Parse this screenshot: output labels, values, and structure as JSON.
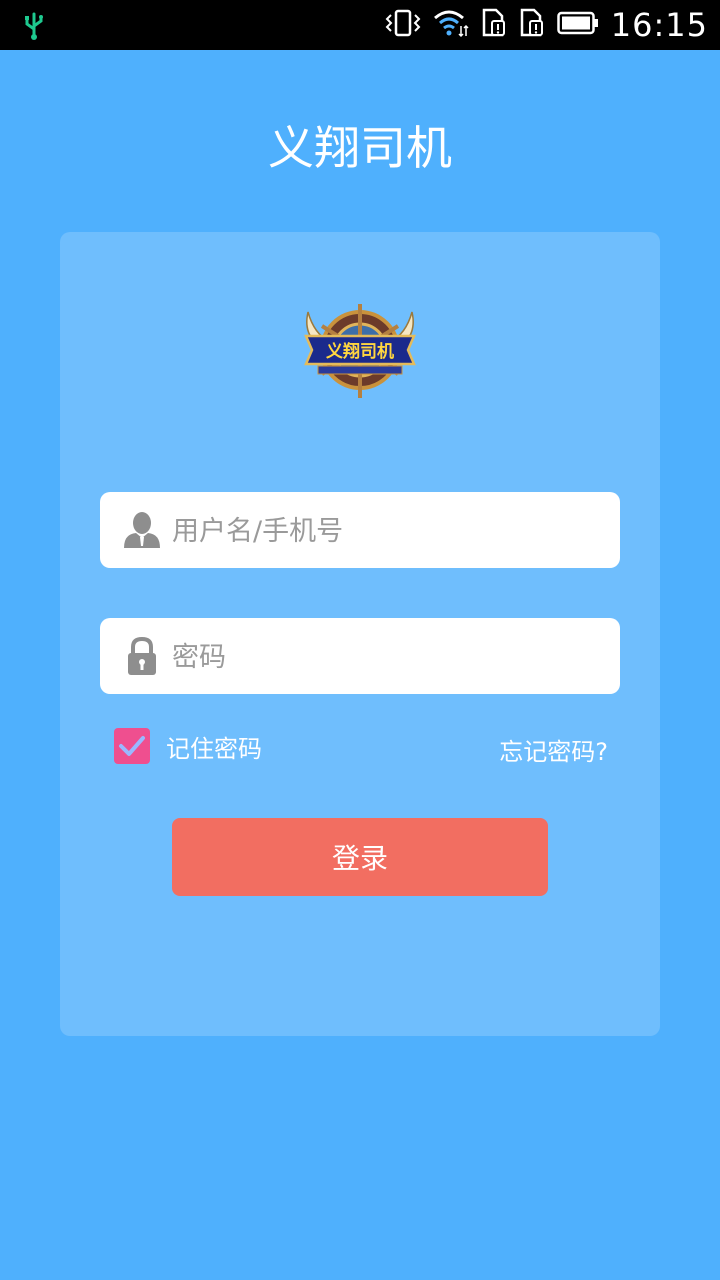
{
  "status_bar": {
    "time": "16:15",
    "icons": [
      "usb-icon",
      "vibrate-icon",
      "wifi-icon",
      "sim1-alert-icon",
      "sim2-alert-icon",
      "battery-icon"
    ]
  },
  "app_title": "义翔司机",
  "logo": {
    "text": "义翔司机"
  },
  "username": {
    "placeholder": "用户名/手机号",
    "value": ""
  },
  "password": {
    "placeholder": "密码",
    "value": ""
  },
  "remember": {
    "label": "记住密码",
    "checked": true
  },
  "forgot_label": "忘记密码?",
  "login_label": "登录",
  "colors": {
    "background": "#4fb0fd",
    "card": "#6fbefd",
    "checkbox": "#ef4f8f",
    "login_button": "#f26e61"
  }
}
